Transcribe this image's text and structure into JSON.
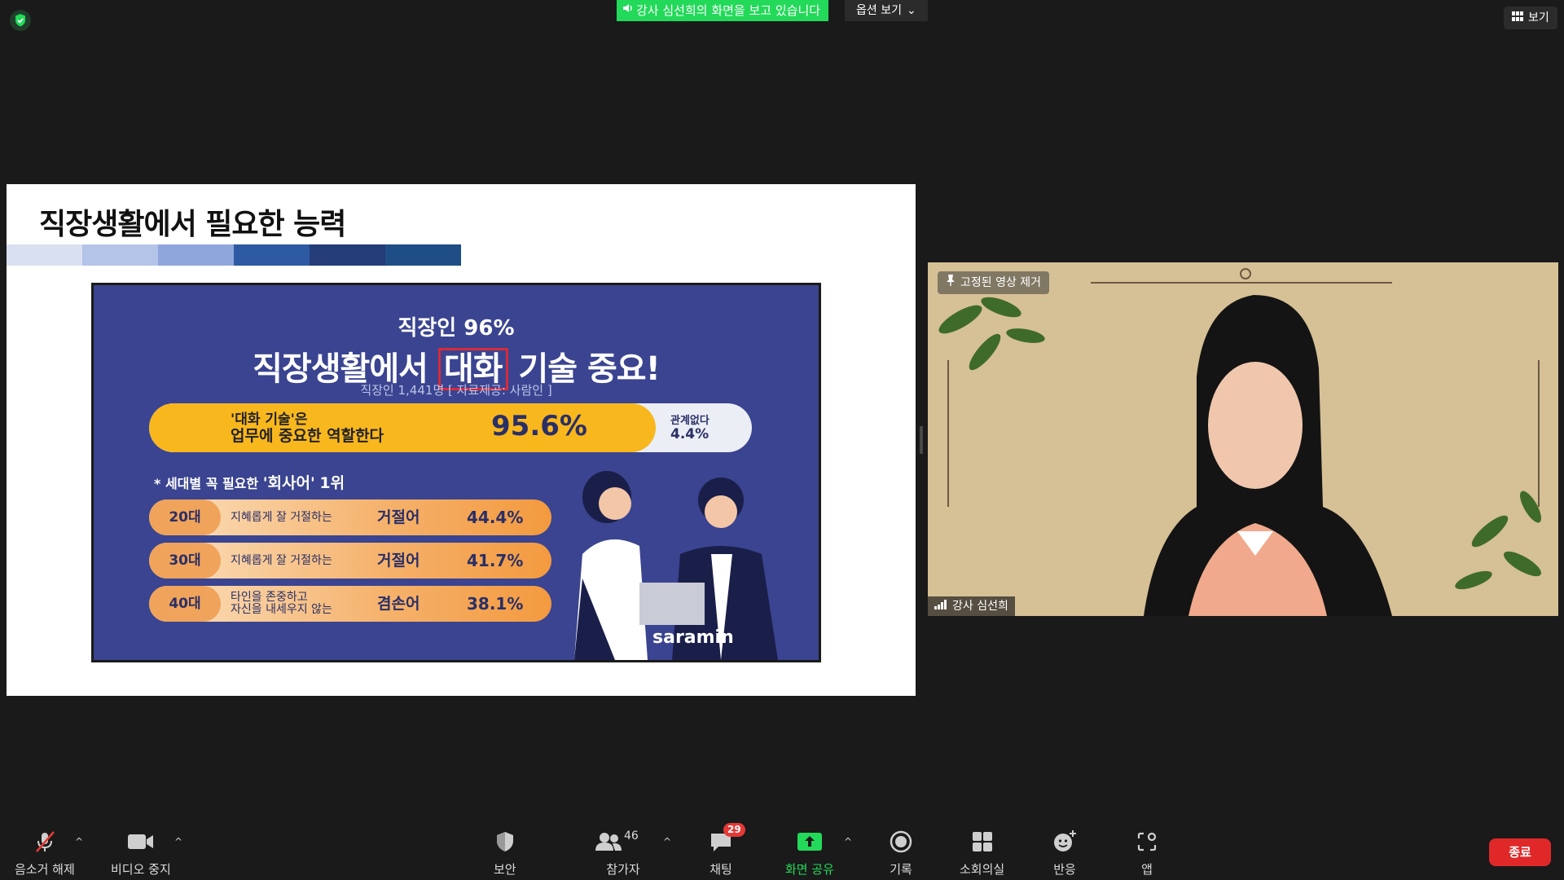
{
  "top": {
    "sharing_notice": "강사 심선희의 화면을 보고 있습니다",
    "view_options": "옵션 보기",
    "view_label": "보기"
  },
  "slide": {
    "title": "직장생활에서 필요한 능력",
    "stripe_colors": [
      "#d9e0f2",
      "#b4c4e8",
      "#8fa6dc",
      "#2e5aa4",
      "#243c78",
      "#1f4e86"
    ],
    "infographic": {
      "subtitle": "직장인 96%",
      "headline_pre": "직장생활에서",
      "headline_highlight": "대화",
      "headline_post": "기술 중요!",
      "source": "직장인 1,441명 [ 자료제공: 사람인 ]",
      "main_bar": {
        "line1": "'대화 기술'은",
        "line2": "업무에 중요한 역할한다",
        "percent": "95.6%",
        "other_label": "관계없다",
        "other_percent": "4.4%",
        "value": 95.6
      },
      "generation_title_pre": "* 세대별 꼭 필요한",
      "generation_title_word": "'회사어'",
      "generation_title_post": "1위",
      "rows": [
        {
          "age": "20대",
          "desc": "지혜롭게 잘 거절하는",
          "desc2": "",
          "word": "거절어",
          "pct": "44.4%"
        },
        {
          "age": "30대",
          "desc": "지혜롭게 잘 거절하는",
          "desc2": "",
          "word": "거절어",
          "pct": "41.7%"
        },
        {
          "age": "40대",
          "desc": "타인을 존중하고",
          "desc2": "자신을 내세우지 않는",
          "word": "겸손어",
          "pct": "38.1%"
        }
      ],
      "brand": "saramin"
    }
  },
  "video": {
    "pin_label": "고정된 영상 제거",
    "name": "강사 심선희"
  },
  "toolbar": {
    "unmute": "음소거 해제",
    "stop_video": "비디오 중지",
    "security": "보안",
    "participants": "참가자",
    "participants_count": "46",
    "chat": "채팅",
    "chat_badge": "29",
    "share_screen": "화면 공유",
    "record": "기록",
    "breakout": "소회의실",
    "reactions": "반응",
    "apps": "앱",
    "end": "종료"
  },
  "colors": {
    "share_green": "#23d959",
    "end_red": "#e02828",
    "badge_red": "#e53935"
  }
}
